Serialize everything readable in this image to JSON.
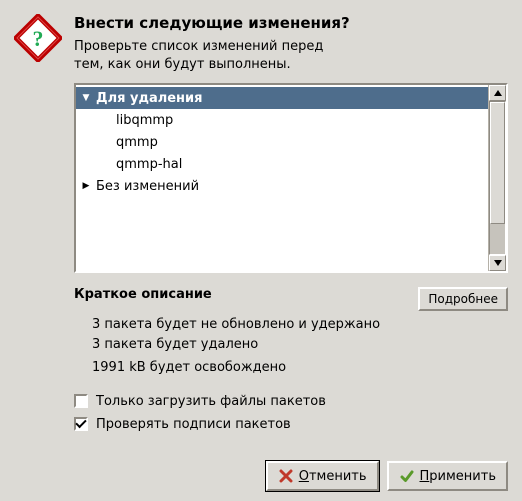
{
  "header": {
    "title": "Внести следующие изменения?",
    "subtitle_line1": "Проверьте список изменений перед",
    "subtitle_line2": "тем, как они будут выполнены."
  },
  "tree": {
    "group_removal": "Для удаления",
    "items": [
      "libqmmp",
      "qmmp",
      "qmmp-hal"
    ],
    "group_unchanged": "Без изменений"
  },
  "summary": {
    "title": "Краткое описание",
    "details_button": "Подробнее",
    "line1": "3 пакета будет не обновлено и удержано",
    "line2": "3 пакета будет удалено",
    "line3": "1991 kB будет освобождено"
  },
  "checks": {
    "download_only": "Только загрузить файлы пакетов",
    "verify_signatures": "Проверять подписи пакетов"
  },
  "buttons": {
    "cancel_prefix": "О",
    "cancel_rest": "тменить",
    "apply_prefix": "П",
    "apply_rest": "рименить"
  }
}
